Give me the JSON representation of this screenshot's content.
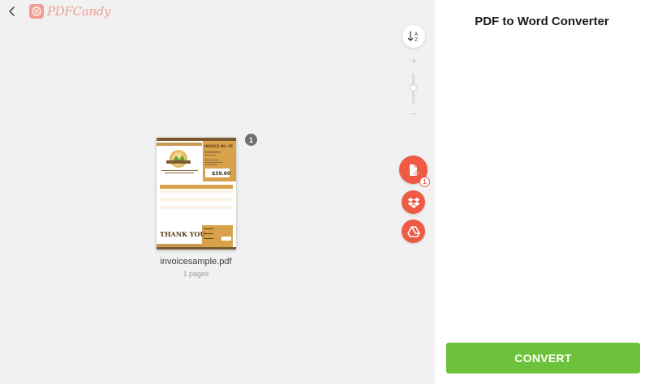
{
  "brand": {
    "name": "PDFCandy"
  },
  "toolbar": {
    "back_icon": "chevron-left-icon",
    "sort_icon": "sort-az-icon",
    "zoom_in": "+",
    "zoom_out": "−"
  },
  "actions": {
    "add_file_icon": "file-plus-icon",
    "add_file_count": "1",
    "dropbox_icon": "dropbox-icon",
    "drive_icon": "google-drive-icon"
  },
  "file": {
    "name": "invoicesample.pdf",
    "pages": "1 pages",
    "page_badge": "1",
    "thumb": {
      "heading": "INVOICE NO. 05",
      "amount": "$39.60",
      "footer": "THANK YOU"
    }
  },
  "panel": {
    "title": "PDF to Word Converter",
    "convert_label": "CONVERT"
  },
  "colors": {
    "accent": "#ef5a44",
    "convert": "#6cc23a",
    "invoice_brown": "#7a5a2e",
    "invoice_gold": "#d8a24a"
  }
}
